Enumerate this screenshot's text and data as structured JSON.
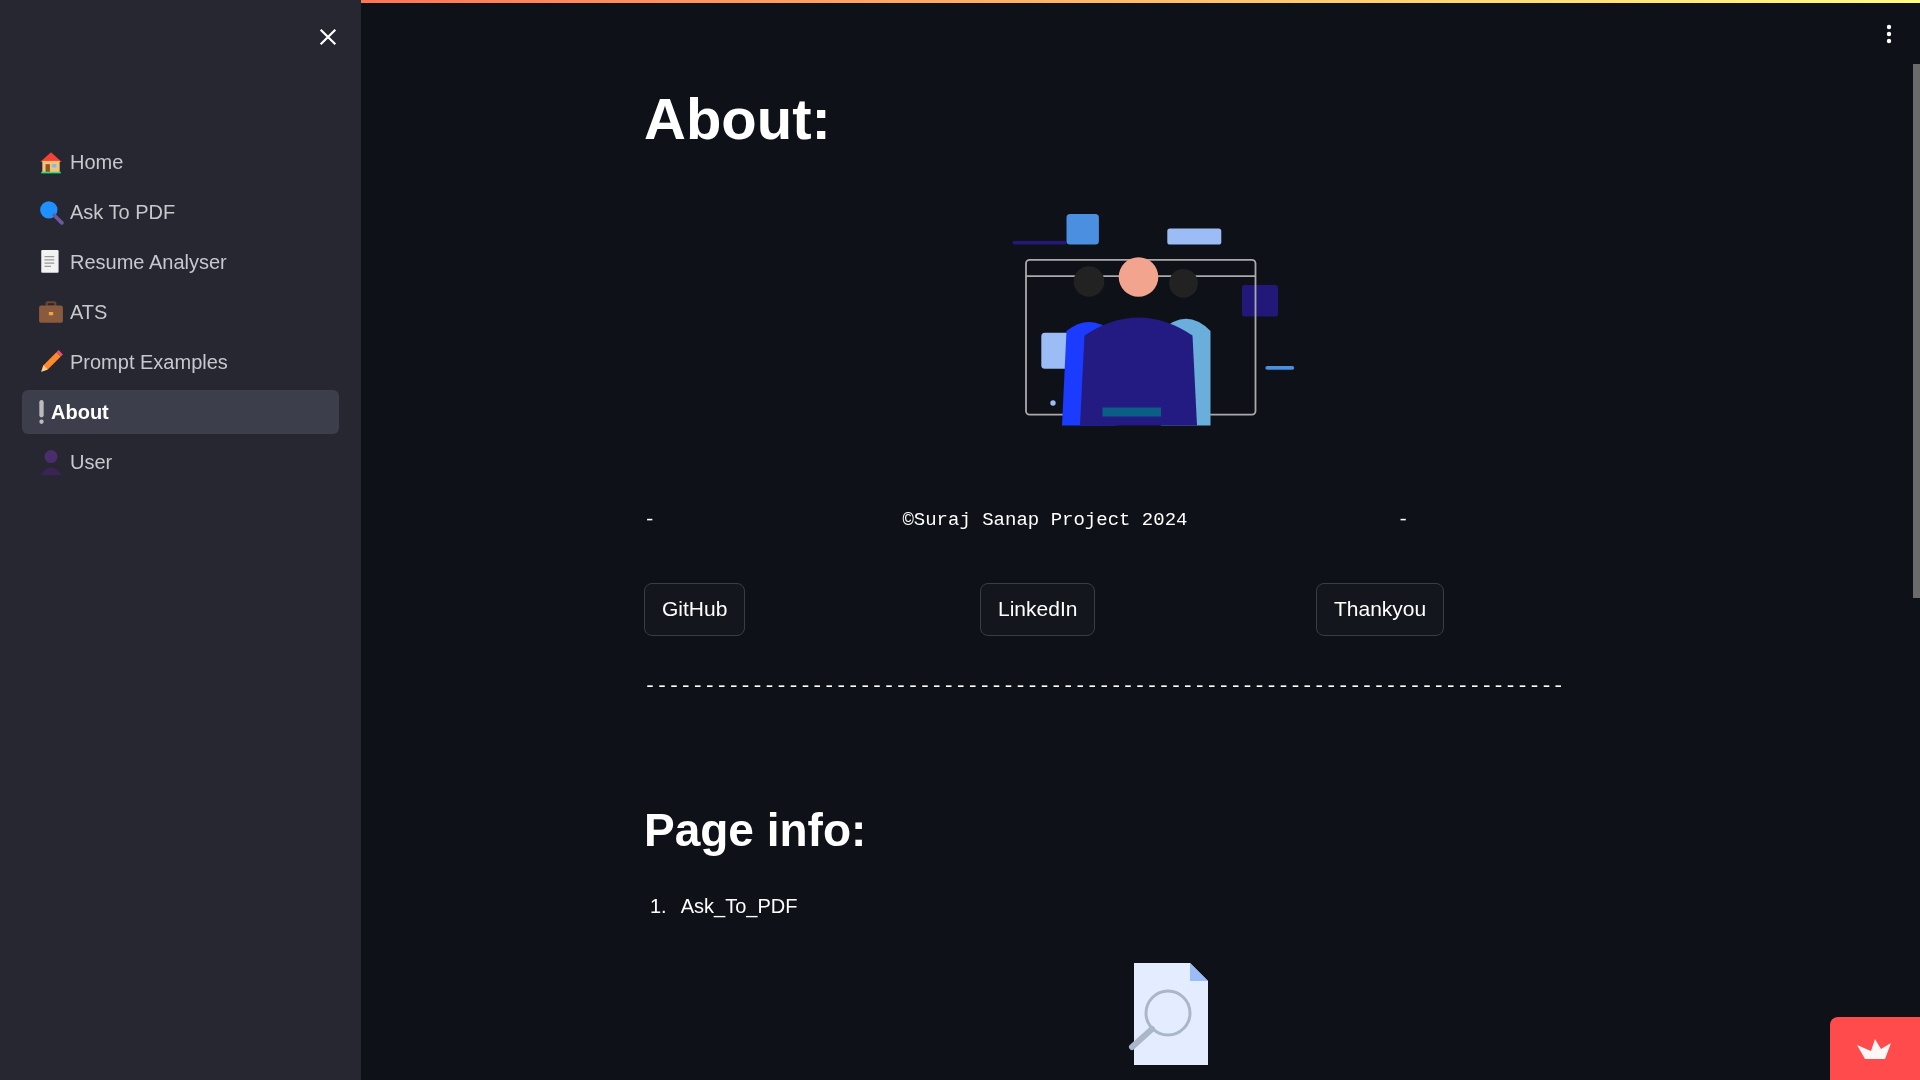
{
  "sidebar": {
    "items": [
      {
        "label": "Home",
        "selected": false
      },
      {
        "label": "Ask To PDF",
        "selected": false
      },
      {
        "label": "Resume Analyser",
        "selected": false
      },
      {
        "label": "ATS",
        "selected": false
      },
      {
        "label": "Prompt Examples",
        "selected": false
      },
      {
        "label": "About",
        "selected": true
      },
      {
        "label": "User",
        "selected": false
      }
    ]
  },
  "main": {
    "title": "About:",
    "copyright_line": {
      "left": "-",
      "text": "©Suraj Sanap Project 2024",
      "right": "-"
    },
    "buttons": [
      "GitHub",
      "LinkedIn",
      "Thankyou"
    ],
    "rule_text": "-----------------------------------------------------------------------------",
    "section_title": "Page info:",
    "list": [
      {
        "number": "1.",
        "text": "Ask_To_PDF"
      }
    ]
  }
}
